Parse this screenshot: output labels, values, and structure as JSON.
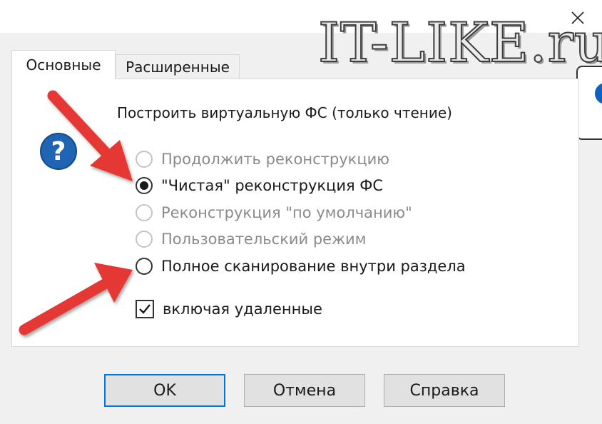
{
  "watermark": "IT-LIKE.ru",
  "tabs": [
    {
      "label": "Основные",
      "active": true
    },
    {
      "label": "Расширенные",
      "active": false
    }
  ],
  "heading": "Построить виртуальную ФС (только чтение)",
  "options": [
    {
      "label": "Продолжить реконструкцию",
      "enabled": false,
      "checked": false
    },
    {
      "label": "\"Чистая\" реконструкция ФС",
      "enabled": true,
      "checked": true
    },
    {
      "label": "Реконструкция \"по умолчанию\"",
      "enabled": false,
      "checked": false
    },
    {
      "label": "Пользовательский режим",
      "enabled": false,
      "checked": false
    },
    {
      "label": "Полное сканирование внутри раздела",
      "enabled": true,
      "checked": false
    }
  ],
  "include_deleted": {
    "label": "включая удаленные",
    "checked": true
  },
  "buttons": {
    "ok": "OK",
    "cancel": "Отмена",
    "help": "Справка"
  },
  "icons": {
    "close": "close-icon",
    "help": "question-icon",
    "checkmark": "checkmark-icon",
    "arrow": "red-arrow-icon"
  },
  "colors": {
    "accent": "#0078d7",
    "help_icon": "#1f65b4",
    "arrow": "#e53935",
    "disabled_text": "#8a8a8a"
  }
}
